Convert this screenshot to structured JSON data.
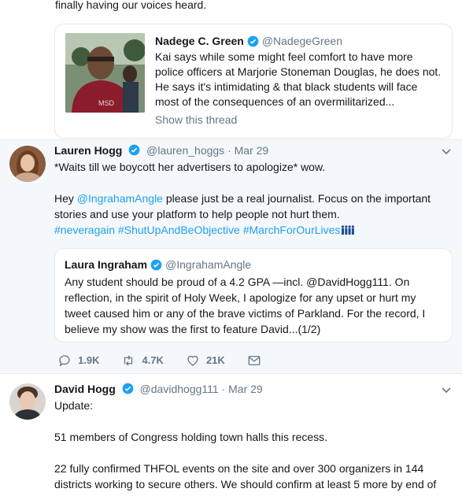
{
  "top_tweet_tail": {
    "text": "finally having our voices heard."
  },
  "quote_card_1": {
    "name": "Nadege C. Green",
    "handle": "@NadegeGreen",
    "text": "Kai says while some might feel comfort to have more police officers at Marjorie Stoneman Douglas, he does not. He says it's intimidating & that black students will face most of the consequences of an overmilitarized...",
    "show_thread": "Show this thread"
  },
  "tweet_2": {
    "name": "Lauren Hogg",
    "handle": "@lauren_hoggs",
    "date": "Mar 29",
    "line1": "*Waits till we boycott her advertisers to apologize* wow.",
    "line2_prefix": "Hey ",
    "line2_mention": "@IngrahamAngle",
    "line2_rest": " please just be a real journalist. Focus on the important stories and use your platform to help people not hurt them.",
    "hashtags": "#neveragain #ShutUpAndBeObjective #MarchForOurLives",
    "quote": {
      "name": "Laura Ingraham",
      "handle": "@IngrahamAngle",
      "text": "Any student should be proud of a 4.2 GPA —incl. @DavidHogg111.  On reflection, in the spirit of Holy Week, I apologize for any upset or hurt my tweet caused him or any of the brave victims of Parkland. For the record, I believe my show was the first to feature David...(1/2)"
    },
    "replies": "1.9K",
    "retweets": "4.7K",
    "likes": "21K"
  },
  "tweet_3": {
    "name": "David Hogg",
    "handle": "@davidhogg111",
    "date": "Mar 29",
    "para1": "Update:",
    "para2": "51 members of Congress holding town halls this recess.",
    "para3": "22 fully confirmed THFOL events on the site and over 300 organizers in 144 districts working to secure others. We should confirm at least 5 more by end of"
  },
  "colors": {
    "accent": "#1da1f2",
    "muted": "#657786",
    "border": "#e1e8ed",
    "highlight_bg": "#f5f8fa"
  }
}
